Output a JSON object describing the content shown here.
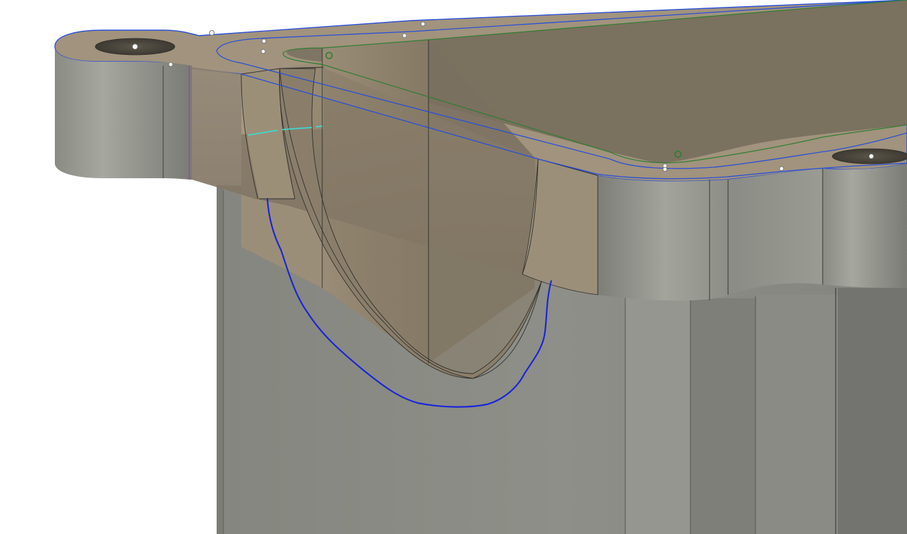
{
  "viewport": {
    "background": "#ffffff",
    "colors": {
      "top_face": "#a1937d",
      "inner_floor": "#7f7564",
      "side_gray": "#8d8e86",
      "lower_wall": "#8b8c86",
      "sketch_blue": "#2a4fd6",
      "selection_blue": "#1a26d8",
      "sketch_green": "#2e7d32",
      "axis_cyan": "#3fd9d2",
      "edge_dark": "#2e2e2b"
    },
    "icons": {
      "vertex_marker": "white-dot",
      "constraint_marker": "green-circle"
    }
  }
}
